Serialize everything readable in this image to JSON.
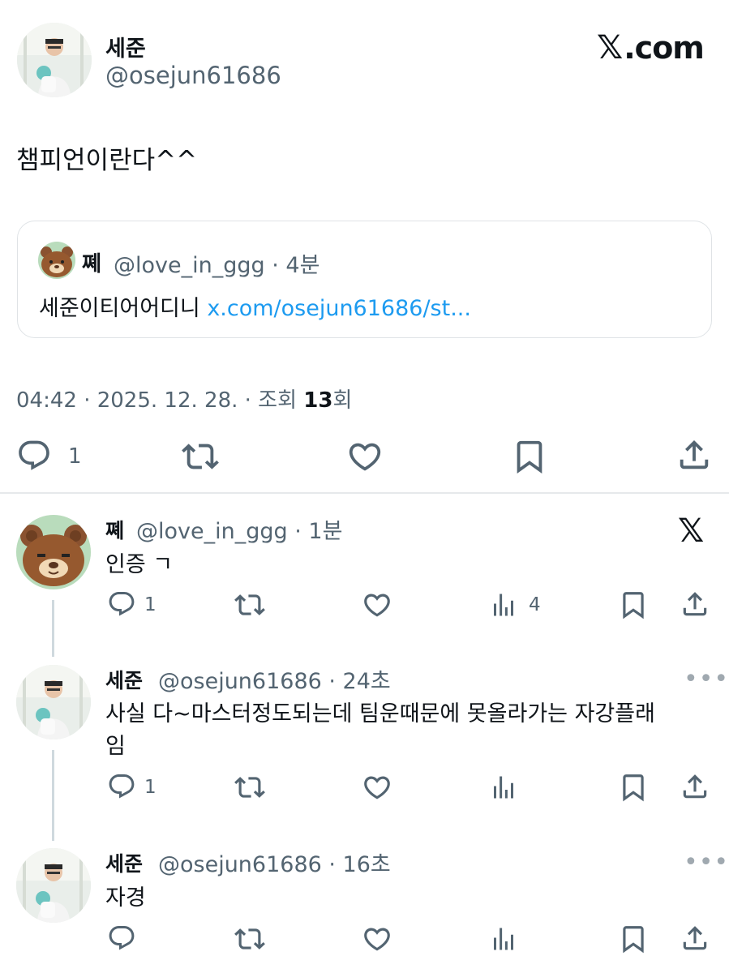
{
  "brand": {
    "site": ".com",
    "logo_glyph": "𝕏"
  },
  "main_tweet": {
    "author_name": "세준",
    "author_handle": "@osejun61686",
    "text": "챔피언이란다^^",
    "quote": {
      "author_name": "쪠",
      "author_handle": "@love_in_ggg · 4분",
      "text": "세준이티어어디니 ",
      "link": "x.com/osejun61686/st..."
    },
    "timestamp": "04:42 · 2025. 12. 28. · 조회 ",
    "views": "13",
    "views_suffix": "회",
    "reply_count": "1"
  },
  "replies": [
    {
      "author_name": "쪠",
      "meta": "@love_in_ggg · 1분",
      "text": "인증 ㄱ",
      "reply_count": "1",
      "views": "4"
    },
    {
      "author_name": "세준",
      "meta": "@osejun61686 · 24초",
      "text_line1": "사실 다~마스터정도되는데 팀운때문에 못올라가는 자강플래",
      "text_line2": "임",
      "reply_count": "1"
    },
    {
      "author_name": "세준",
      "meta": "@osejun61686 · 16초",
      "text": "자경"
    }
  ],
  "more_menu": "•••",
  "icons": [
    "reply-icon",
    "retweet-icon",
    "like-icon",
    "bookmark-icon",
    "share-icon",
    "views-icon",
    "more-icon",
    "x-logo-icon"
  ]
}
